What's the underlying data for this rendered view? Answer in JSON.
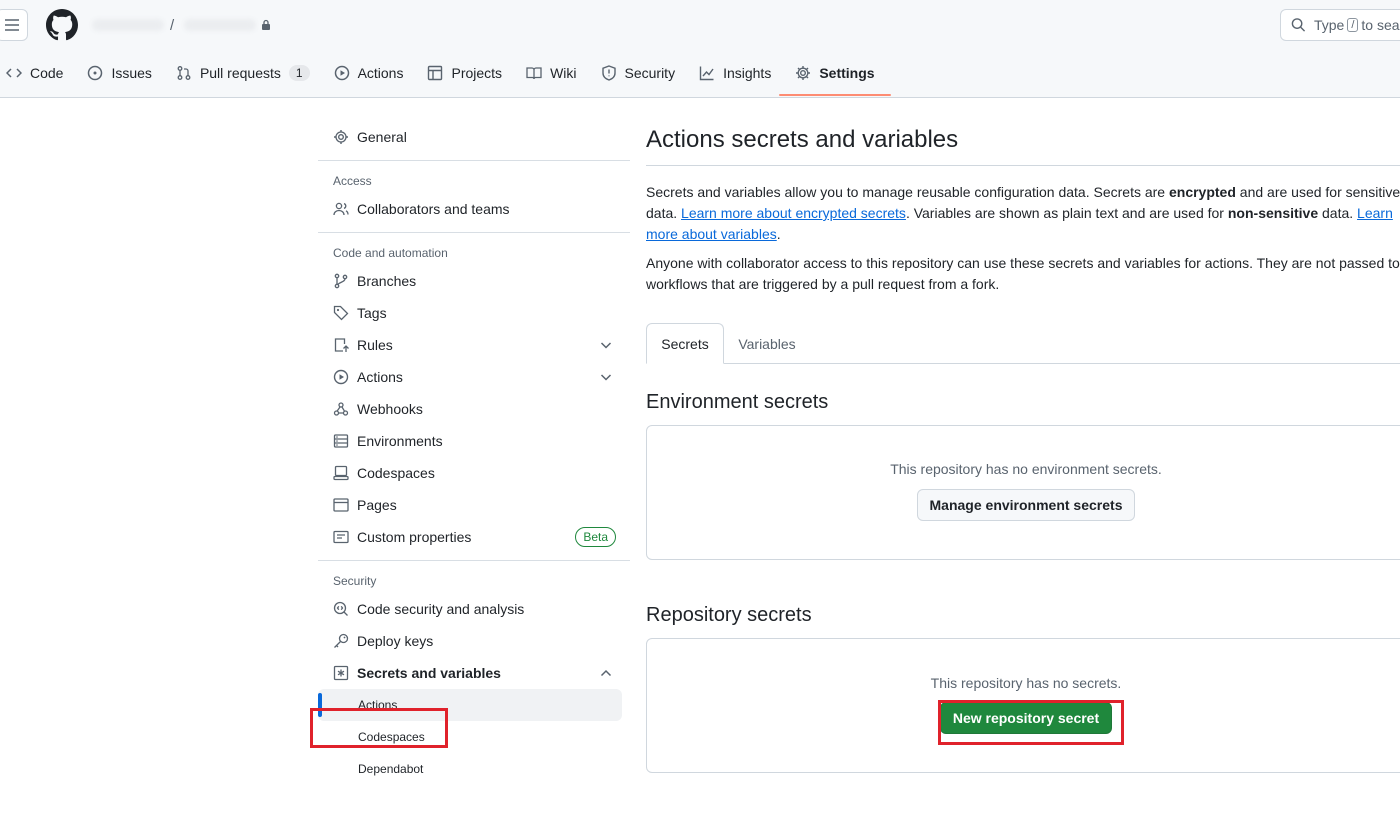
{
  "header": {
    "search_prefix": "Type",
    "search_key": "/",
    "search_suffix": "to search",
    "path_separator": "/"
  },
  "nav": {
    "tabs": [
      {
        "label": "Code",
        "icon": "code-icon"
      },
      {
        "label": "Issues",
        "icon": "issue-opened-icon"
      },
      {
        "label": "Pull requests",
        "icon": "git-pull-request-icon",
        "count": "1"
      },
      {
        "label": "Actions",
        "icon": "play-icon"
      },
      {
        "label": "Projects",
        "icon": "table-icon"
      },
      {
        "label": "Wiki",
        "icon": "book-icon"
      },
      {
        "label": "Security",
        "icon": "shield-icon"
      },
      {
        "label": "Insights",
        "icon": "graph-icon"
      },
      {
        "label": "Settings",
        "icon": "gear-icon",
        "active": true
      }
    ],
    "active_underline_color": "#fd8c73"
  },
  "sidebar": {
    "general": "General",
    "access_heading": "Access",
    "collaborators": "Collaborators and teams",
    "code_heading": "Code and automation",
    "branches": "Branches",
    "tags": "Tags",
    "rules": "Rules",
    "actions": "Actions",
    "webhooks": "Webhooks",
    "environments": "Environments",
    "codespaces": "Codespaces",
    "pages": "Pages",
    "custom_properties": "Custom properties",
    "beta_badge": "Beta",
    "security_heading": "Security",
    "code_security": "Code security and analysis",
    "deploy_keys": "Deploy keys",
    "secrets_vars": "Secrets and variables",
    "sub_actions": "Actions",
    "sub_codespaces": "Codespaces",
    "sub_dependabot": "Dependabot"
  },
  "main": {
    "title": "Actions secrets and variables",
    "desc1_a": "Secrets and variables allow you to manage reusable configuration data. Secrets are ",
    "desc1_b": "encrypted",
    "desc1_c": " and are used for sensitive data. ",
    "desc1_link1": "Learn more about encrypted secrets",
    "desc1_d": ". Variables are shown as plain text and are used for ",
    "desc1_e": "non-sensitive",
    "desc1_f": " data. ",
    "desc1_link2": "Learn more about variables",
    "desc1_g": ".",
    "desc2": "Anyone with collaborator access to this repository can use these secrets and variables for actions. They are not passed to workflows that are triggered by a pull request from a fork.",
    "tab_secrets": "Secrets",
    "tab_variables": "Variables",
    "env_title": "Environment secrets",
    "env_msg": "This repository has no environment secrets.",
    "env_button": "Manage environment secrets",
    "repo_title": "Repository secrets",
    "repo_msg": "This repository has no secrets.",
    "repo_button": "New repository secret"
  },
  "colors": {
    "primary_button": "#1f883d",
    "link": "#0969da",
    "annotation_box": "#e0222b",
    "selected_indicator": "#0969da"
  }
}
